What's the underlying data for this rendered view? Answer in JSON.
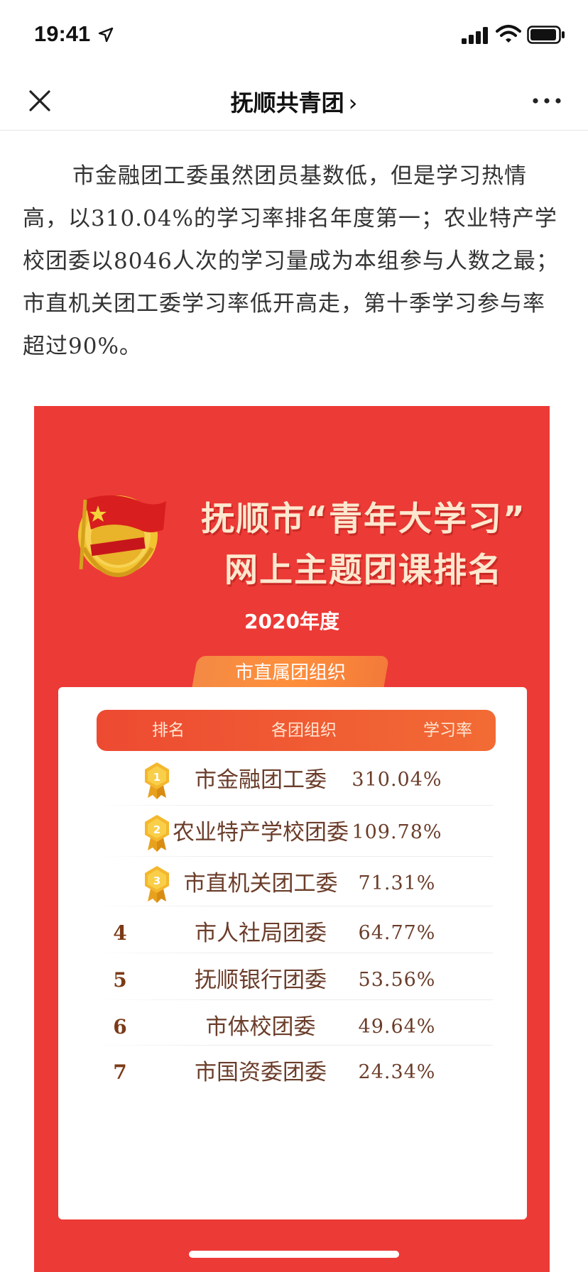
{
  "status_bar": {
    "time": "19:41",
    "icons": [
      "location-arrow-icon",
      "signal-icon",
      "wifi-icon",
      "battery-icon"
    ]
  },
  "nav": {
    "title": "抚顺共青团",
    "title_chevron": "›",
    "close_icon": "close-icon",
    "more_icon": "more-icon"
  },
  "article": {
    "paragraph": "市金融团工委虽然团员基数低，但是学习热情高，以310.04%的学习率排名年度第一；农业特产学校团委以8046人次的学习量成为本组参与人数之最；市直机关团工委学习率低开高走，第十季学习参与率超过90%。"
  },
  "poster": {
    "title_line1": "抚顺市“青年大学习”",
    "title_line2": "网上主题团课排名",
    "year": "2020年度",
    "group_tab": "市直属团组织",
    "colors": {
      "background": "#ec3a36",
      "title": "#fde8cf",
      "medal": "#f2b12b",
      "rank_text": "#7b3a17"
    },
    "table": {
      "headers": {
        "rank": "排名",
        "org": "各团组织",
        "rate": "学习率"
      },
      "rows": [
        {
          "rank": "1",
          "medal": true,
          "org": "市金融团工委",
          "rate": "310.04%"
        },
        {
          "rank": "2",
          "medal": true,
          "org": "农业特产学校团委",
          "rate": "109.78%"
        },
        {
          "rank": "3",
          "medal": true,
          "org": "市直机关团工委",
          "rate": "71.31%"
        },
        {
          "rank": "4",
          "medal": false,
          "org": "市人社局团委",
          "rate": "64.77%"
        },
        {
          "rank": "5",
          "medal": false,
          "org": "抚顺银行团委",
          "rate": "53.56%"
        },
        {
          "rank": "6",
          "medal": false,
          "org": "市体校团委",
          "rate": "49.64%"
        },
        {
          "rank": "7",
          "medal": false,
          "org": "市国资委团委",
          "rate": "24.34%"
        }
      ]
    }
  }
}
